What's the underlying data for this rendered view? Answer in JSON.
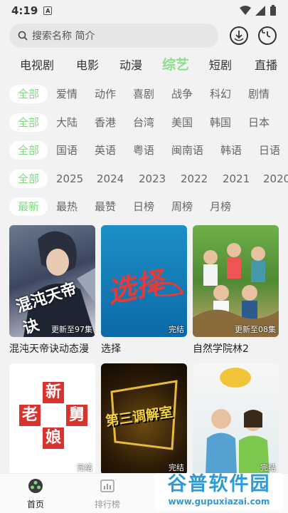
{
  "status": {
    "time": "4:19",
    "notif": "A"
  },
  "search": {
    "placeholder": "搜索名称 简介"
  },
  "categories": [
    "电视剧",
    "电影",
    "动漫",
    "综艺",
    "短剧",
    "直播"
  ],
  "filters": {
    "genre": [
      "全部",
      "爱情",
      "动作",
      "喜剧",
      "战争",
      "科幻",
      "剧情"
    ],
    "region": [
      "全部",
      "大陆",
      "香港",
      "台湾",
      "美国",
      "韩国",
      "日本"
    ],
    "language": [
      "全部",
      "国语",
      "英语",
      "粤语",
      "闽南语",
      "韩语",
      "日语"
    ],
    "year": [
      "全部",
      "2025",
      "2024",
      "2023",
      "2022",
      "2021",
      "2020"
    ],
    "sort": [
      "最新",
      "最热",
      "最赞",
      "日榜",
      "周榜",
      "月榜"
    ]
  },
  "cards": [
    {
      "title": "混沌天帝诀动态漫",
      "badge": "更新至97集",
      "poster_text": "混沌天帝诀"
    },
    {
      "title": "选择",
      "badge": "完结",
      "poster_text": "选择"
    },
    {
      "title": "自然学院林2",
      "badge": "更新至08集",
      "poster_text": ""
    },
    {
      "title": "",
      "badge": "完结",
      "poster_text": "新舅老娘"
    },
    {
      "title": "",
      "badge": "完结",
      "poster_text": "第三调解室"
    },
    {
      "title": "",
      "badge": "完结",
      "poster_text": ""
    }
  ],
  "poster_glyphs": [
    "新",
    "老",
    "舅",
    "娘"
  ],
  "nav": {
    "home": "首页",
    "rank": "排行榜"
  },
  "watermark": {
    "top": "谷普软件园",
    "bottom": "www.gupuxiazai.com"
  },
  "colors": {
    "accent": "#7fd87f"
  }
}
